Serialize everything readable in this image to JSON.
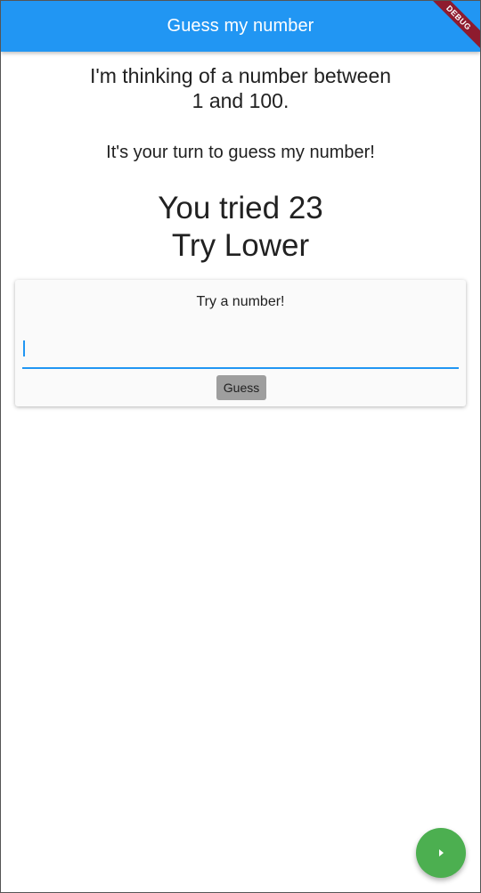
{
  "app_bar": {
    "title": "Guess my number",
    "debug_banner": "DEBUG",
    "background": "#2196f3"
  },
  "main": {
    "intro_line1": "I'm thinking of a number between",
    "intro_line2": "1 and 100.",
    "prompt": "It's your turn to guess my number!",
    "result_line1": "You tried 23",
    "result_line2": "Try Lower"
  },
  "card": {
    "title": "Try a number!",
    "input_value": "",
    "input_placeholder": "",
    "button_label": "Guess"
  },
  "fab": {
    "icon": "play-arrow-icon",
    "color": "#4caf50"
  }
}
